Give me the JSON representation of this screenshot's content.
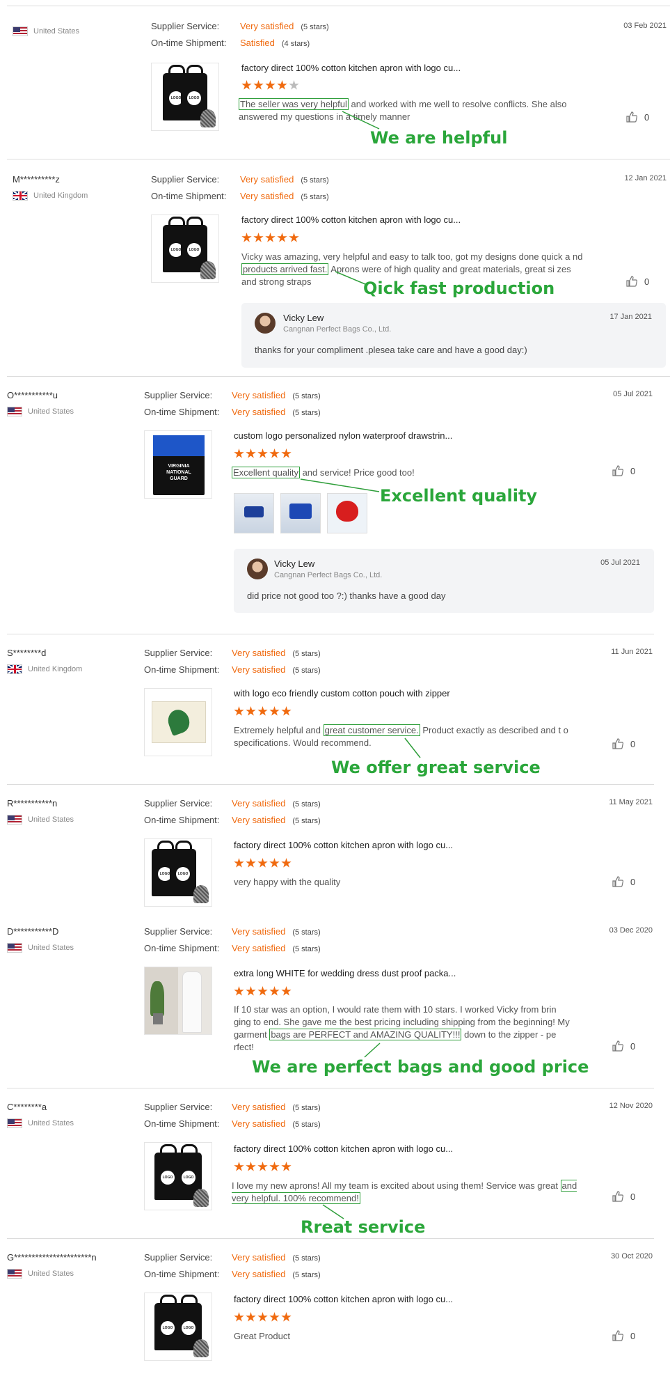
{
  "labels": {
    "supplier_service": "Supplier Service:",
    "ontime_shipment": "On-time Shipment:"
  },
  "reviews": [
    {
      "buyer": "",
      "country": "United States",
      "supplier": "Very satisfied",
      "supplier_stars": "(5 stars)",
      "shipment": "Satisfied",
      "shipment_stars": "(4 stars)",
      "date": "03 Feb 2021",
      "product": "factory direct 100% cotton kitchen apron with logo cu...",
      "rating": 4,
      "text_before": "",
      "highlight": "The seller was very helpful",
      "text_after": " and worked with me well to resolve conflicts. She also answered my questions in a timely manner",
      "annotation": "We are helpful",
      "likes": "0"
    },
    {
      "buyer": "M**********z",
      "country": "United Kingdom",
      "supplier": "Very satisfied",
      "supplier_stars": "(5 stars)",
      "shipment": "Very satisfied",
      "shipment_stars": "(5 stars)",
      "date": "12 Jan 2021",
      "product": "factory direct 100% cotton kitchen apron with logo cu...",
      "rating": 5,
      "text_before": "Vicky was amazing, very helpful and easy to talk too, got my designs done quick a nd ",
      "highlight": "products arrived fast.",
      "text_after": " Aprons were of high quality and great materials, great si zes and strong straps",
      "annotation": "Qick fast production",
      "likes": "0",
      "reply": {
        "name": "Vicky Lew",
        "company": "Cangnan Perfect Bags Co., Ltd.",
        "date": "17 Jan 2021",
        "message": "thanks for your compliment .plesea take care and have a good day:)"
      }
    },
    {
      "buyer": "O***********u",
      "country": "United States",
      "supplier": "Very satisfied",
      "supplier_stars": "(5 stars)",
      "shipment": "Very satisfied",
      "shipment_stars": "(5 stars)",
      "date": "05 Jul 2021",
      "product": "custom logo personalized nylon waterproof drawstrin...",
      "rating": 5,
      "text_before": "",
      "highlight": "Excellent quality",
      "text_after": " and service! Price good too!",
      "annotation": "Excellent quality",
      "likes": "0",
      "thumb_text": "VIRGINIA NATIONAL GUARD",
      "reply": {
        "name": "Vicky Lew",
        "company": "Cangnan Perfect Bags Co., Ltd.",
        "date": "05 Jul 2021",
        "message": "did price not good too ?:) thanks have a good day"
      }
    },
    {
      "buyer": "S********d",
      "country": "United Kingdom",
      "supplier": "Very satisfied",
      "supplier_stars": "(5 stars)",
      "shipment": "Very satisfied",
      "shipment_stars": "(5 stars)",
      "date": "11 Jun 2021",
      "product": "with logo eco friendly custom cotton pouch with zipper",
      "rating": 5,
      "text_before": "Extremely helpful and ",
      "highlight": "great customer service.",
      "text_after": " Product exactly as described and t o specifications. Would recommend.",
      "annotation": "We offer great service",
      "likes": "0"
    },
    {
      "buyer": "R***********n",
      "country": "United States",
      "supplier": "Very satisfied",
      "supplier_stars": "(5 stars)",
      "shipment": "Very satisfied",
      "shipment_stars": "(5 stars)",
      "date": "11 May 2021",
      "product": "factory direct 100% cotton kitchen apron with logo cu...",
      "rating": 5,
      "text_before": "very happy with the quality",
      "highlight": "",
      "text_after": "",
      "annotation": "",
      "likes": "0"
    },
    {
      "buyer": "D***********D",
      "country": "United States",
      "supplier": "Very satisfied",
      "supplier_stars": "(5 stars)",
      "shipment": "Very satisfied",
      "shipment_stars": "(5 stars)",
      "date": "03 Dec 2020",
      "product": "extra long WHITE for wedding dress dust proof packa...",
      "rating": 5,
      "text_before": "If 10 star was an option, I would rate them with 10 stars. I worked Vicky from brin ging to end. She gave me the best pricing including shipping from the beginning! My garment ",
      "highlight": "bags are PERFECT and AMAZING QUALITY!!!",
      "text_after": " down to the zipper - pe rfect!",
      "annotation": "We are perfect bags and good price",
      "likes": "0"
    },
    {
      "buyer": "C********a",
      "country": "United States",
      "supplier": "Very satisfied",
      "supplier_stars": "(5 stars)",
      "shipment": "Very satisfied",
      "shipment_stars": "(5 stars)",
      "date": "12 Nov 2020",
      "product": "factory direct 100% cotton kitchen apron with logo cu...",
      "rating": 5,
      "text_before": "I love my new aprons! All my team is excited about using them! Service was great ",
      "highlight": "and very helpful. 100% recommend!",
      "text_after": "",
      "annotation": "Rreat service",
      "likes": "0"
    },
    {
      "buyer": "G**********************n",
      "country": "United States",
      "supplier": "Very satisfied",
      "supplier_stars": "(5 stars)",
      "shipment": "Very satisfied",
      "shipment_stars": "(5 stars)",
      "date": "30 Oct 2020",
      "product": "factory direct 100% cotton kitchen apron with logo cu...",
      "rating": 5,
      "text_before": "Great Product",
      "highlight": "",
      "text_after": "",
      "annotation": "",
      "likes": "0"
    }
  ]
}
